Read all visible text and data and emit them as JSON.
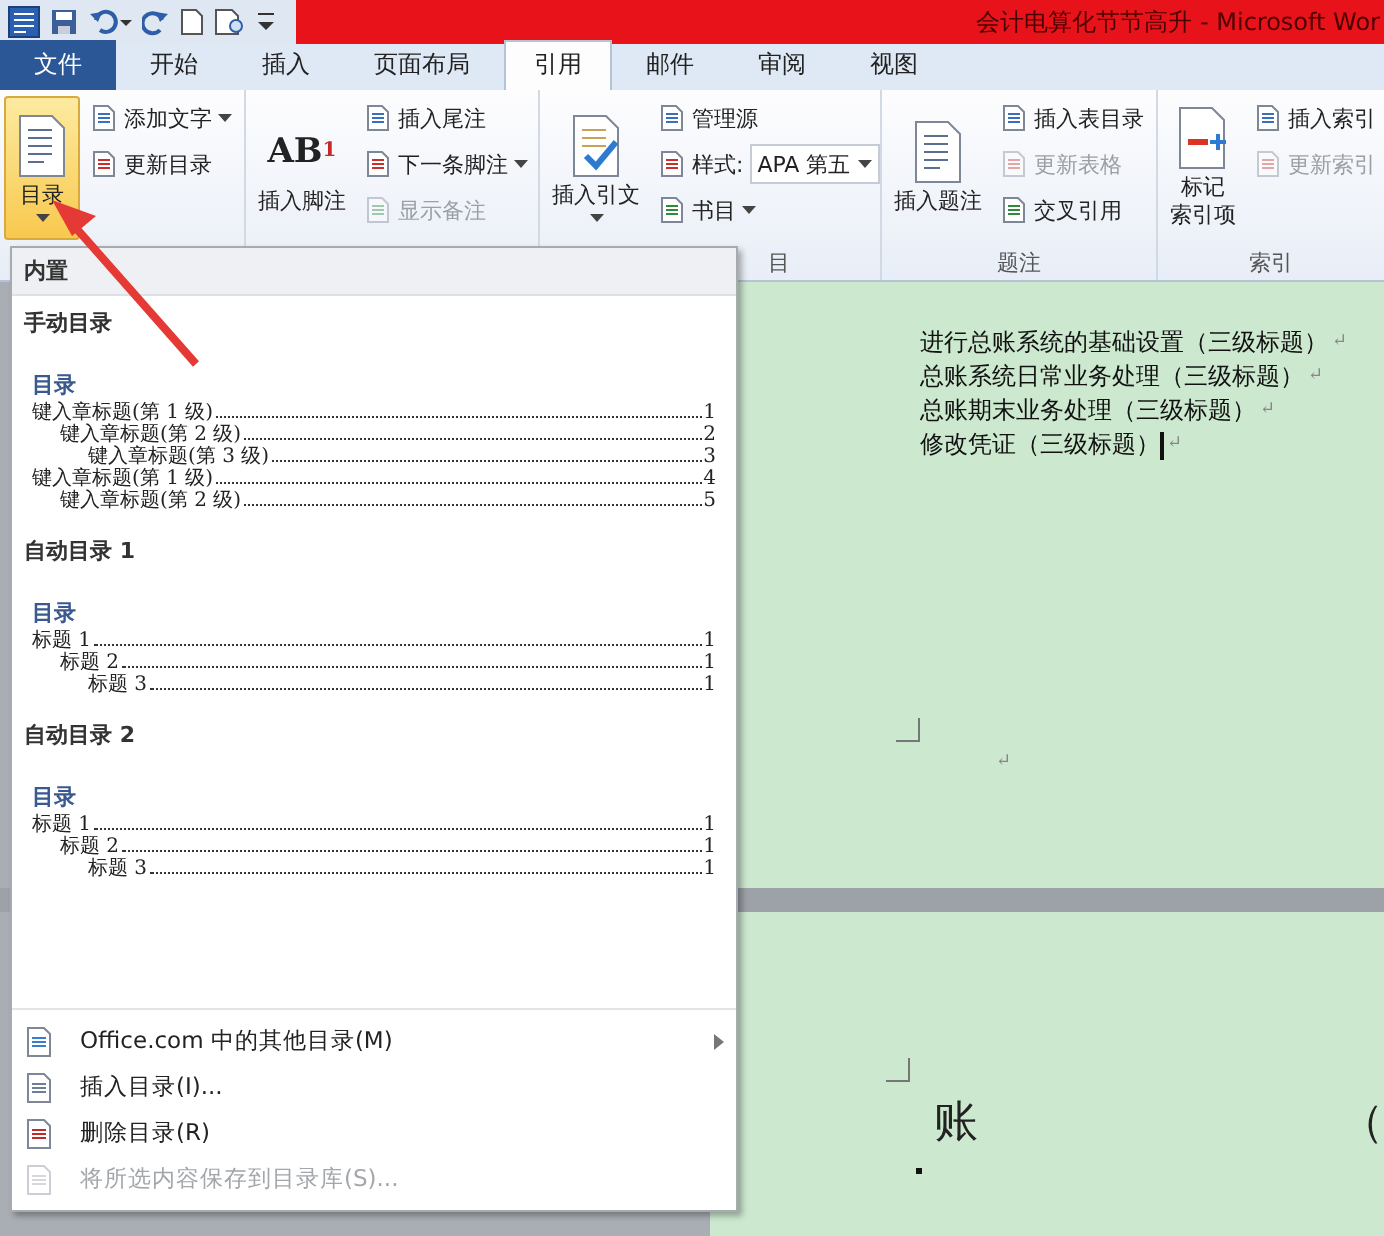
{
  "title_bar": {
    "title": "会计电算化节节高升 - Microsoft Wor"
  },
  "tabs": [
    {
      "label": "文件",
      "kind": "file",
      "selected": false
    },
    {
      "label": "开始",
      "kind": "tab",
      "selected": false
    },
    {
      "label": "插入",
      "kind": "tab",
      "selected": false
    },
    {
      "label": "页面布局",
      "kind": "tab",
      "selected": false
    },
    {
      "label": "引用",
      "kind": "tab",
      "selected": true
    },
    {
      "label": "邮件",
      "kind": "tab",
      "selected": false
    },
    {
      "label": "审阅",
      "kind": "tab",
      "selected": false
    },
    {
      "label": "视图",
      "kind": "tab",
      "selected": false
    }
  ],
  "ribbon": {
    "groups": [
      {
        "large": {
          "label_lines": [
            "目录"
          ],
          "dropdown": true,
          "pressed": true
        },
        "small": [
          {
            "kind": "button",
            "label": "添加文字",
            "dropdown": true,
            "disabled": false
          },
          {
            "kind": "button",
            "label": "更新目录",
            "disabled": false
          }
        ]
      },
      {
        "large": {
          "label_lines": [
            "插入脚注"
          ],
          "icon_text": "AB$^{1}$",
          "pressed": false
        },
        "small": [
          {
            "kind": "button",
            "label": "插入尾注",
            "disabled": false
          },
          {
            "kind": "button",
            "label": "下一条脚注",
            "dropdown": true,
            "disabled": false
          },
          {
            "kind": "button",
            "label": "显示备注",
            "disabled": true
          }
        ]
      },
      {
        "label": "目",
        "label_cut": true,
        "large": {
          "label_lines": [
            "插入引文"
          ],
          "dropdown": true,
          "pressed": false
        },
        "small": [
          {
            "kind": "button",
            "label": "管理源",
            "disabled": false
          },
          {
            "kind": "combo",
            "label": "样式:",
            "value": "APA 第五"
          },
          {
            "kind": "button",
            "label": "书目",
            "dropdown": true,
            "disabled": false
          }
        ]
      },
      {
        "label": "题注",
        "label_cut": false,
        "large": {
          "label_lines": [
            "插入题注"
          ],
          "pressed": false
        },
        "small": [
          {
            "kind": "button",
            "label": "插入表目录",
            "disabled": false
          },
          {
            "kind": "button",
            "label": "更新表格",
            "disabled": true
          },
          {
            "kind": "button",
            "label": "交叉引用",
            "disabled": false
          }
        ]
      },
      {
        "label": "索引",
        "label_cut": false,
        "large": {
          "label_lines": [
            "标记",
            "索引项"
          ],
          "pressed": false
        },
        "small": [
          {
            "kind": "button",
            "label": "插入索引",
            "disabled": false
          },
          {
            "kind": "button",
            "label": "更新索引",
            "disabled": true
          }
        ]
      }
    ]
  },
  "toc_menu": {
    "header": "内置",
    "sections": [
      {
        "title": "手动目录",
        "preview": {
          "heading": "目录",
          "entries": [
            {
              "text": "键入章标题(第 1 级)",
              "page": "1",
              "children": [
                {
                  "text": "键入章标题(第 2 级)",
                  "page": "2",
                  "children": [
                    {
                      "text": "键入章标题(第 3 级)",
                      "page": "3"
                    }
                  ]
                }
              ]
            },
            {
              "text": "键入章标题(第 1 级)",
              "page": "4",
              "children": [
                {
                  "text": "键入章标题(第 2 级)",
                  "page": "5"
                }
              ]
            }
          ]
        }
      },
      {
        "title": "自动目录 1",
        "preview": {
          "heading": "目录",
          "entries": [
            {
              "text": "标题 1",
              "page": "1",
              "children": [
                {
                  "text": "标题 2",
                  "page": "1",
                  "children": [
                    {
                      "text": "标题 3",
                      "page": "1"
                    }
                  ]
                }
              ]
            }
          ]
        }
      },
      {
        "title": "自动目录 2",
        "preview": {
          "heading": "目录",
          "entries": [
            {
              "text": "标题 1",
              "page": "1",
              "children": [
                {
                  "text": "标题 2",
                  "page": "1",
                  "children": [
                    {
                      "text": "标题 3",
                      "page": "1"
                    }
                  ]
                }
              ]
            }
          ]
        }
      }
    ],
    "items": [
      {
        "label": "Office.com 中的其他目录(M)",
        "submenu": true,
        "disabled": false
      },
      {
        "label": "插入目录(I)...",
        "disabled": false
      },
      {
        "label": "删除目录(R)",
        "disabled": false
      },
      {
        "label": "将所选内容保存到目录库(S)...",
        "disabled": true
      }
    ]
  },
  "document": {
    "page_1": {
      "paragraphs": [
        {
          "text": "进行总账系统的基础设置（三级标题）",
          "mark": "↵"
        },
        {
          "text": "总账系统日常业务处理（三级标题）",
          "mark": "↵"
        },
        {
          "text": "总账期末业务处理（三级标题）",
          "mark": "↵"
        },
        {
          "text": "修改凭证（三级标题）",
          "mark": "↵",
          "cursor": true
        }
      ],
      "empty_paragraph_mark": "↵"
    },
    "page_2": {
      "heading_fragments": [
        "账",
        "（"
      ]
    }
  }
}
